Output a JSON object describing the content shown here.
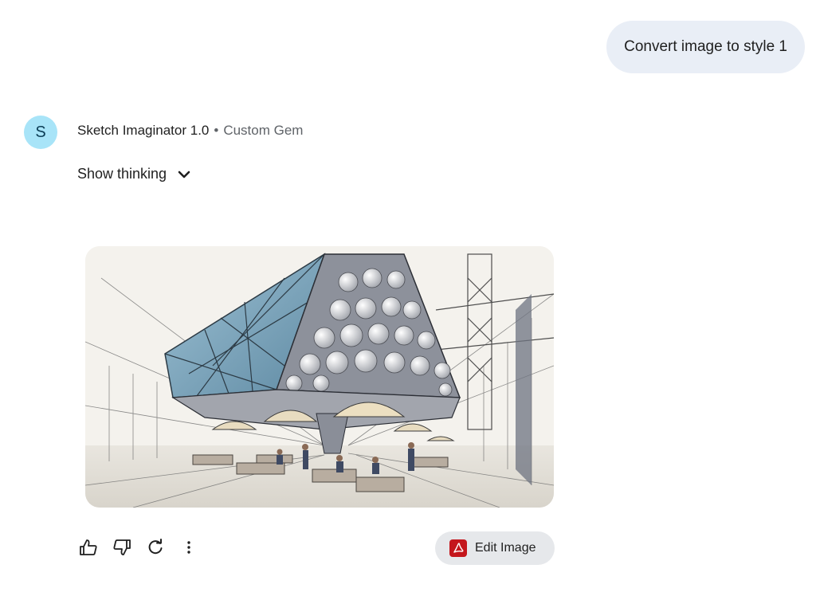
{
  "user_prompt": "Convert image to style 1",
  "response": {
    "avatar_letter": "S",
    "gem_name": "Sketch Imaginator 1.0",
    "separator": "•",
    "gem_type": "Custom Gem",
    "show_thinking_label": "Show thinking"
  },
  "actions": {
    "icons": [
      "thumbs-up-icon",
      "thumbs-down-icon",
      "redo-icon",
      "more-vert-icon"
    ],
    "edit_image_label": "Edit Image"
  },
  "colors": {
    "user_bubble": "#e9eef6",
    "avatar_bg": "#a8e4f8",
    "edit_button_bg": "#e6e8eb",
    "edit_icon_bg": "#c4161c"
  }
}
